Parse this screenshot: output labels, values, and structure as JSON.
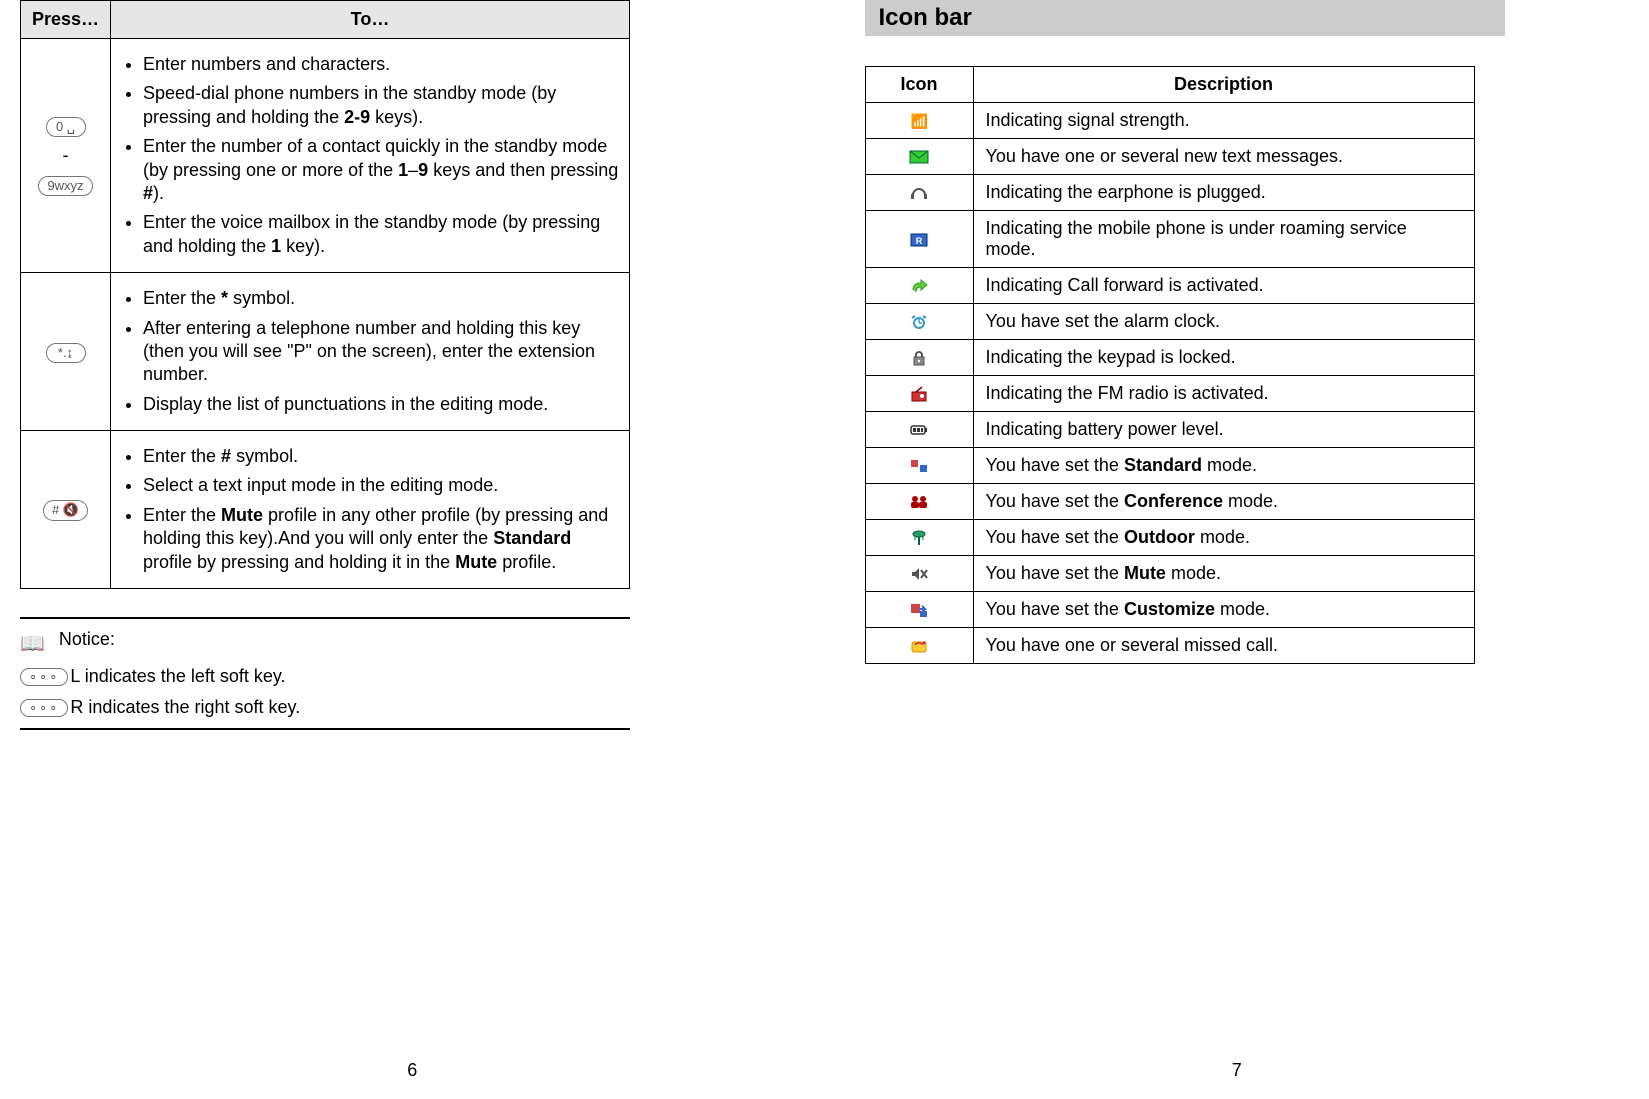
{
  "left_page": {
    "table_headers": {
      "press": "Press…",
      "to": "To…"
    },
    "rows": [
      {
        "key_top": "0 ␣",
        "key_sep": "-",
        "key_bot": "9wxyz",
        "items": [
          "Enter numbers and characters.",
          "Speed-dial phone numbers in the standby mode (by pressing and holding the <b>2-9</b> keys).",
          "Enter the number of a contact quickly in the standby mode (by pressing one or more of the <b>1</b>–<b>9</b> keys and then pressing <b>#</b>).",
          "Enter the voice mailbox in the standby mode (by pressing and holding the <b>1</b> key)."
        ]
      },
      {
        "key": "*.↨",
        "items": [
          "Enter the <b>*</b> symbol.",
          "After entering a telephone number and holding this key (then you will see \"P\" on the screen), enter the extension number.",
          "Display the list of punctuations in the editing mode."
        ]
      },
      {
        "key": "# 🔇",
        "items": [
          "Enter the <b>#</b> symbol.",
          "Select a text input mode in the editing mode.",
          "Enter the <b>Mute</b> profile in any other profile (by pressing and holding this key).And you will only enter the <b>Standard</b> profile by pressing and holding it in the <b>Mute</b> profile."
        ]
      }
    ],
    "notice_label": "Notice:",
    "softkey_left": "L indicates the left soft key.",
    "softkey_right": "R indicates the right soft key.",
    "softkey_cap": "∘∘∘",
    "page_number": "6"
  },
  "right_page": {
    "heading": "Icon bar",
    "table_headers": {
      "icon": "Icon",
      "description": "Description"
    },
    "rows": [
      {
        "icon": "signal",
        "desc": "Indicating signal strength."
      },
      {
        "icon": "envelope",
        "desc": "You have one or several new text messages."
      },
      {
        "icon": "earphone",
        "desc": "Indicating the earphone is plugged."
      },
      {
        "icon": "roaming",
        "desc": "Indicating the mobile phone is under roaming service mode."
      },
      {
        "icon": "forward",
        "desc": "Indicating Call forward is activated."
      },
      {
        "icon": "alarm",
        "desc": "You have set the alarm clock."
      },
      {
        "icon": "lock",
        "desc": "Indicating the keypad is locked."
      },
      {
        "icon": "radio",
        "desc": "Indicating the FM radio is activated."
      },
      {
        "icon": "battery",
        "desc": "Indicating battery power level."
      },
      {
        "icon": "standard",
        "desc": "You have set the <b>Standard</b> mode."
      },
      {
        "icon": "conference",
        "desc": "You have set the <b>Conference</b> mode."
      },
      {
        "icon": "outdoor",
        "desc": "You have set the <b>Outdoor</b> mode."
      },
      {
        "icon": "mute",
        "desc": "You have set the <b>Mute</b> mode."
      },
      {
        "icon": "customize",
        "desc": "You have set the <b>Customize</b> mode."
      },
      {
        "icon": "missed",
        "desc": "You have one or several missed call."
      }
    ],
    "page_number": "7"
  }
}
